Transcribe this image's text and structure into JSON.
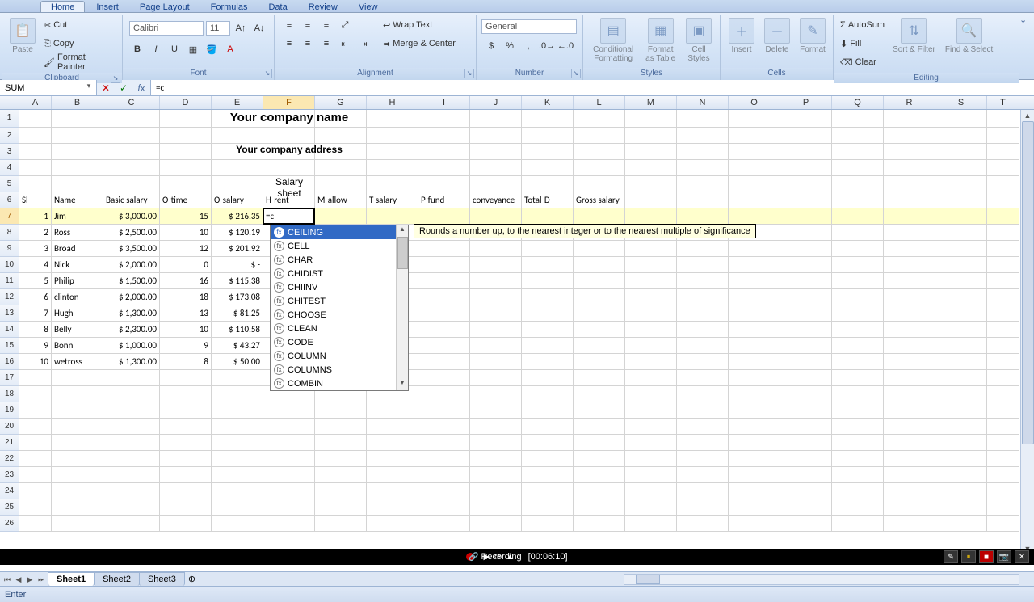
{
  "ribbon": {
    "tabs": [
      "Home",
      "Insert",
      "Page Layout",
      "Formulas",
      "Data",
      "Review",
      "View"
    ],
    "active_tab": "Home",
    "groups": {
      "clipboard": {
        "label": "Clipboard",
        "paste": "Paste",
        "cut": "Cut",
        "copy": "Copy",
        "format_painter": "Format Painter"
      },
      "font": {
        "label": "Font",
        "name": "Calibri",
        "size": "11"
      },
      "alignment": {
        "label": "Alignment",
        "wrap": "Wrap Text",
        "merge": "Merge & Center"
      },
      "number": {
        "label": "Number",
        "format": "General"
      },
      "styles": {
        "label": "Styles",
        "cond": "Conditional\nFormatting",
        "fmt_table": "Format\nas Table",
        "cell_styles": "Cell\nStyles"
      },
      "cells": {
        "label": "Cells",
        "insert": "Insert",
        "delete": "Delete",
        "format": "Format"
      },
      "editing": {
        "label": "Editing",
        "autosum": "AutoSum",
        "fill": "Fill",
        "clear": "Clear",
        "sort": "Sort &\nFilter",
        "find": "Find &\nSelect"
      }
    }
  },
  "name_box": "SUM",
  "formula_bar_value": "=c",
  "active_cell_value": "=c",
  "columns": [
    {
      "id": "A",
      "w": 40
    },
    {
      "id": "B",
      "w": 64
    },
    {
      "id": "C",
      "w": 70
    },
    {
      "id": "D",
      "w": 64
    },
    {
      "id": "E",
      "w": 64
    },
    {
      "id": "F",
      "w": 64
    },
    {
      "id": "G",
      "w": 64
    },
    {
      "id": "H",
      "w": 64
    },
    {
      "id": "I",
      "w": 64
    },
    {
      "id": "J",
      "w": 64
    },
    {
      "id": "K",
      "w": 64
    },
    {
      "id": "L",
      "w": 64
    },
    {
      "id": "M",
      "w": 64
    },
    {
      "id": "N",
      "w": 64
    },
    {
      "id": "O",
      "w": 64
    },
    {
      "id": "P",
      "w": 64
    },
    {
      "id": "Q",
      "w": 64
    },
    {
      "id": "R",
      "w": 64
    },
    {
      "id": "S",
      "w": 64
    },
    {
      "id": "T",
      "w": 40
    }
  ],
  "sheet": {
    "company_name": "Your company name",
    "company_address": "Your company address",
    "title": "Salary sheet",
    "headers": [
      "Sl",
      "Name",
      "Basic salary",
      "O-time",
      "O-salary",
      "H-rent",
      "M-allow",
      "T-salary",
      "P-fund",
      "conveyance",
      "Total-D",
      "Gross salary"
    ],
    "rows": [
      {
        "sl": 1,
        "name": "Jim",
        "basic": "$ 3,000.00",
        "ot": 15,
        "os": "$ 216.35"
      },
      {
        "sl": 2,
        "name": "Ross",
        "basic": "$ 2,500.00",
        "ot": 10,
        "os": "$ 120.19"
      },
      {
        "sl": 3,
        "name": "Broad",
        "basic": "$ 3,500.00",
        "ot": 12,
        "os": "$ 201.92"
      },
      {
        "sl": 4,
        "name": "Nick",
        "basic": "$ 2,000.00",
        "ot": 0,
        "os": "$      -"
      },
      {
        "sl": 5,
        "name": "Philip",
        "basic": "$ 1,500.00",
        "ot": 16,
        "os": "$ 115.38"
      },
      {
        "sl": 6,
        "name": "clinton",
        "basic": "$ 2,000.00",
        "ot": 18,
        "os": "$ 173.08"
      },
      {
        "sl": 7,
        "name": "Hugh",
        "basic": "$ 1,300.00",
        "ot": 13,
        "os": "$   81.25"
      },
      {
        "sl": 8,
        "name": "Belly",
        "basic": "$ 2,300.00",
        "ot": 10,
        "os": "$ 110.58"
      },
      {
        "sl": 9,
        "name": "Bonn",
        "basic": "$ 1,000.00",
        "ot": 9,
        "os": "$   43.27"
      },
      {
        "sl": 10,
        "name": "wetross",
        "basic": "$ 1,300.00",
        "ot": 8,
        "os": "$   50.00"
      }
    ]
  },
  "autocomplete": {
    "items": [
      "CEILING",
      "CELL",
      "CHAR",
      "CHIDIST",
      "CHIINV",
      "CHITEST",
      "CHOOSE",
      "CLEAN",
      "CODE",
      "COLUMN",
      "COLUMNS",
      "COMBIN"
    ],
    "selected": 0,
    "tooltip": "Rounds a number up, to the nearest integer or to the nearest multiple of significance"
  },
  "sheet_tabs": [
    "Sheet1",
    "Sheet2",
    "Sheet3"
  ],
  "active_sheet": 0,
  "status_mode": "Enter",
  "recording": {
    "label": "Recording",
    "time": "[00:06:10]"
  },
  "chart_data": {
    "type": "table",
    "title": "Salary sheet",
    "columns": [
      "Sl",
      "Name",
      "Basic salary",
      "O-time",
      "O-salary"
    ],
    "rows": [
      [
        1,
        "Jim",
        3000.0,
        15,
        216.35
      ],
      [
        2,
        "Ross",
        2500.0,
        10,
        120.19
      ],
      [
        3,
        "Broad",
        3500.0,
        12,
        201.92
      ],
      [
        4,
        "Nick",
        2000.0,
        0,
        0.0
      ],
      [
        5,
        "Philip",
        1500.0,
        16,
        115.38
      ],
      [
        6,
        "clinton",
        2000.0,
        18,
        173.08
      ],
      [
        7,
        "Hugh",
        1300.0,
        13,
        81.25
      ],
      [
        8,
        "Belly",
        2300.0,
        10,
        110.58
      ],
      [
        9,
        "Bonn",
        1000.0,
        9,
        43.27
      ],
      [
        10,
        "wetross",
        1300.0,
        8,
        50.0
      ]
    ]
  }
}
